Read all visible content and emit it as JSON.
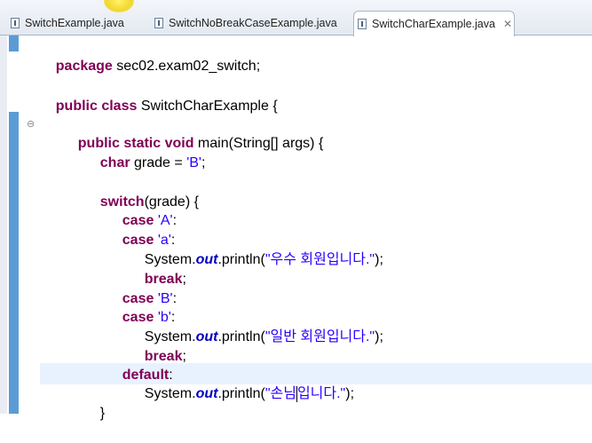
{
  "tabs": [
    {
      "label": "SwitchExample.java",
      "active": false
    },
    {
      "label": "SwitchNoBreakCaseExample.java",
      "active": false
    },
    {
      "label": "SwitchCharExample.java",
      "active": true
    }
  ],
  "close_glyph": "✕",
  "code": {
    "line1": {
      "kw": "package",
      "rest": " sec02.exam02_switch;"
    },
    "line2": {
      "kw": "public class",
      "rest": " SwitchCharExample {"
    },
    "line3": {
      "kw": "public static void",
      "rest": " main(String[] args) {"
    },
    "line4": {
      "kw": "char",
      "rest": " grade = ",
      "str": "'B'",
      "end": ";"
    },
    "line5": {
      "kw": "switch",
      "rest": "(grade) {"
    },
    "case_a_upper": {
      "kw": "case",
      "str": "'A'",
      "end": ":"
    },
    "case_a_lower": {
      "kw": "case",
      "str": "'a'",
      "end": ":"
    },
    "print1": {
      "pre": "System.",
      "field": "out",
      "mid": ".println(",
      "str": "\"우수 회원입니다.\"",
      "end": ");"
    },
    "break1": {
      "kw": "break",
      "end": ";"
    },
    "case_b_upper": {
      "kw": "case",
      "str": "'B'",
      "end": ":"
    },
    "case_b_lower": {
      "kw": "case",
      "str": "'b'",
      "end": ":"
    },
    "print2": {
      "pre": "System.",
      "field": "out",
      "mid": ".println(",
      "str": "\"일반 회원입니다.\"",
      "end": ");"
    },
    "break2": {
      "kw": "break",
      "end": ";"
    },
    "default_line": {
      "kw": "default",
      "end": ":"
    },
    "print3": {
      "pre": "System.",
      "field": "out",
      "mid": ".println(",
      "str_a": "\"손님",
      "str_b": "입니다.\"",
      "end": ");"
    },
    "close_brace": {
      "text": "}"
    }
  },
  "icons": {
    "fold": "circle-minus-icon",
    "java_file": "java-file-icon"
  },
  "colors": {
    "keyword": "#7f0055",
    "string": "#2a00ff",
    "field": "#0000c0",
    "ruler": "#5b9bd5",
    "current_line": "#e8f2fe"
  }
}
